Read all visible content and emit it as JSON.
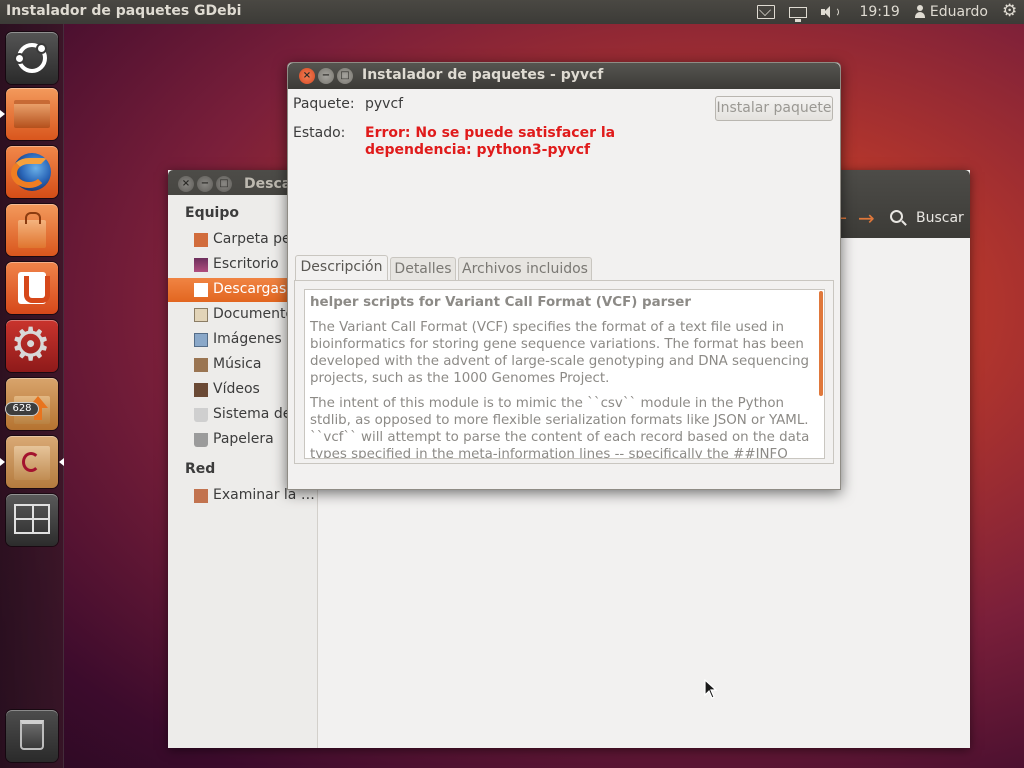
{
  "top_panel": {
    "app_title": "Instalador de paquetes GDebi",
    "clock": "19:19",
    "user": "Eduardo"
  },
  "launcher": {
    "items": [
      "ubuntu-dash",
      "files",
      "firefox",
      "ubuntu-software-center",
      "ubuntu-one",
      "system-settings",
      "update-manager",
      "gdebi",
      "workspace-switcher",
      "trash"
    ],
    "update_badge": "628"
  },
  "file_manager": {
    "title": "Desca",
    "search_label": "Buscar",
    "sidebar": {
      "heading_equipo": "Equipo",
      "heading_red": "Red",
      "items": [
        {
          "label": "Carpeta pe",
          "icon": "home-folder-icon"
        },
        {
          "label": "Escritorio",
          "icon": "desktop-icon"
        },
        {
          "label": "Descargas",
          "icon": "download-icon",
          "active": true
        },
        {
          "label": "Documento",
          "icon": "documents-icon"
        },
        {
          "label": "Imágenes",
          "icon": "pictures-icon"
        },
        {
          "label": "Música",
          "icon": "music-icon"
        },
        {
          "label": "Vídeos",
          "icon": "videos-icon"
        },
        {
          "label": "Sistema de",
          "icon": "filesystem-icon"
        },
        {
          "label": "Papelera",
          "icon": "trash-icon"
        }
      ],
      "network_items": [
        {
          "label": "Examinar la …",
          "icon": "network-icon"
        }
      ]
    }
  },
  "gdebi": {
    "title": "Instalador de paquetes - pyvcf",
    "package_label": "Paquete:",
    "package_value": "pyvcf",
    "status_label": "Estado:",
    "status_error": "Error: No se puede satisfacer la dependencia: python3-pyvcf",
    "install_button": "Instalar paquete",
    "tabs": [
      "Descripción",
      "Detalles",
      "Archivos incluidos"
    ],
    "active_tab": "Descripción",
    "description": {
      "summary": "helper scripts for Variant Call Format (VCF) parser",
      "para1": "The Variant Call Format (VCF) specifies the format of a text file used in bioinformatics for storing gene sequence variations. The format has been developed with the advent of large-scale genotyping and DNA sequencing projects, such as the 1000 Genomes Project.",
      "para2": "The intent of this module is to mimic the ``csv`` module in the Python stdlib, as opposed to more flexible serialization formats like JSON or YAML. ``vcf`` will attempt to parse the content of each record based on the data types specified in the meta-information lines -- specifically the ##INFO and"
    }
  },
  "colors": {
    "accent": "#e0783b",
    "error": "#e01b1b",
    "panel": "#3c3b37",
    "window_bg": "#f2f1f0"
  }
}
